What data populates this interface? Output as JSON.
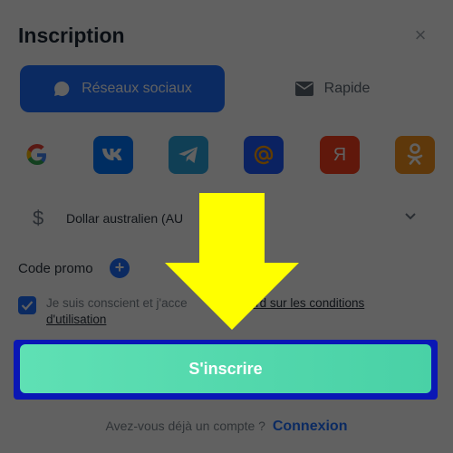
{
  "modal": {
    "title": "Inscription",
    "close_label": "×"
  },
  "tabs": [
    {
      "label": "Réseaux sociaux",
      "icon": "chat-icon",
      "active": true
    },
    {
      "label": "Rapide",
      "icon": "mail-icon",
      "active": false
    }
  ],
  "social": [
    {
      "name": "Google",
      "icon": "google-icon",
      "color": "#ffffff"
    },
    {
      "name": "VK",
      "icon": "vk-icon",
      "color": "#0077ff"
    },
    {
      "name": "Telegram",
      "icon": "telegram-icon",
      "color": "#2aa5e0"
    },
    {
      "name": "Mail.ru",
      "icon": "mailru-icon",
      "color": "#1e5bff"
    },
    {
      "name": "Yandex",
      "icon": "yandex-icon",
      "color": "#fc3f1d",
      "glyph": "Я"
    },
    {
      "name": "Odnoklassniki",
      "icon": "ok-icon",
      "color": "#f7931e"
    }
  ],
  "currency": {
    "symbol": "$",
    "value": "Dollar australien (AU"
  },
  "promo": {
    "label": "Code promo",
    "plus": "+"
  },
  "terms": {
    "checked": true,
    "text_start": "Je suis conscient et j'acce",
    "text_link_tail": "ord sur les conditions",
    "text_link_line2": "d'utilisation"
  },
  "submit": {
    "label": "S'inscrire"
  },
  "login": {
    "prompt": "Avez-vous déjà un compte ?",
    "link": "Connexion"
  },
  "colors": {
    "accent": "#1d6fff",
    "submit": "#49d1a6",
    "highlight_frame": "#0a17b5",
    "arrow": "#ffff00"
  }
}
